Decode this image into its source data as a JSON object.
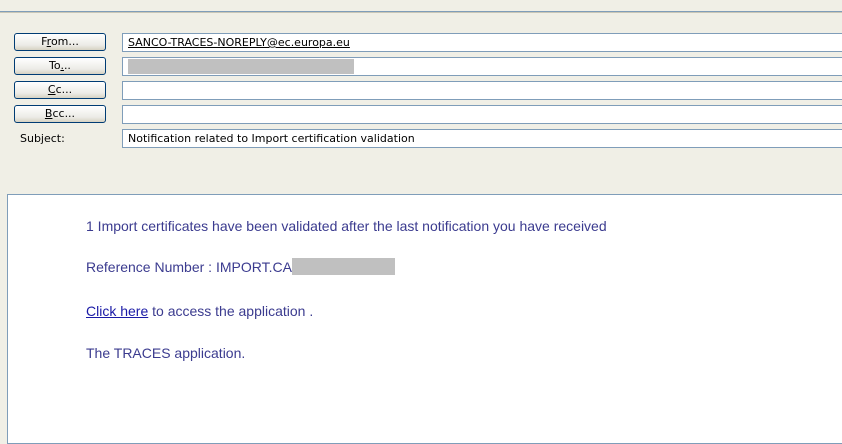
{
  "header": {
    "from_button": {
      "pre": "F",
      "u": "r",
      "post": "om..."
    },
    "to_button": {
      "pre": "To",
      "u": ".",
      "post": ".."
    },
    "cc_button": {
      "pre": "",
      "u": "C",
      "post": "c..."
    },
    "bcc_button": {
      "pre": "",
      "u": "B",
      "post": "cc..."
    },
    "from_value": "SANCO-TRACES-NOREPLY@ec.europa.eu",
    "subject_label": "Subject:",
    "subject_value": "Notification related to Import certification validation"
  },
  "message": {
    "line1": "1 Import certificates have been validated after the last notification you have received",
    "reference_prefix": "Reference Number : IMPORT.CA",
    "link_text": "Click here",
    "link_suffix": " to access the application .",
    "signature": "The TRACES application."
  }
}
